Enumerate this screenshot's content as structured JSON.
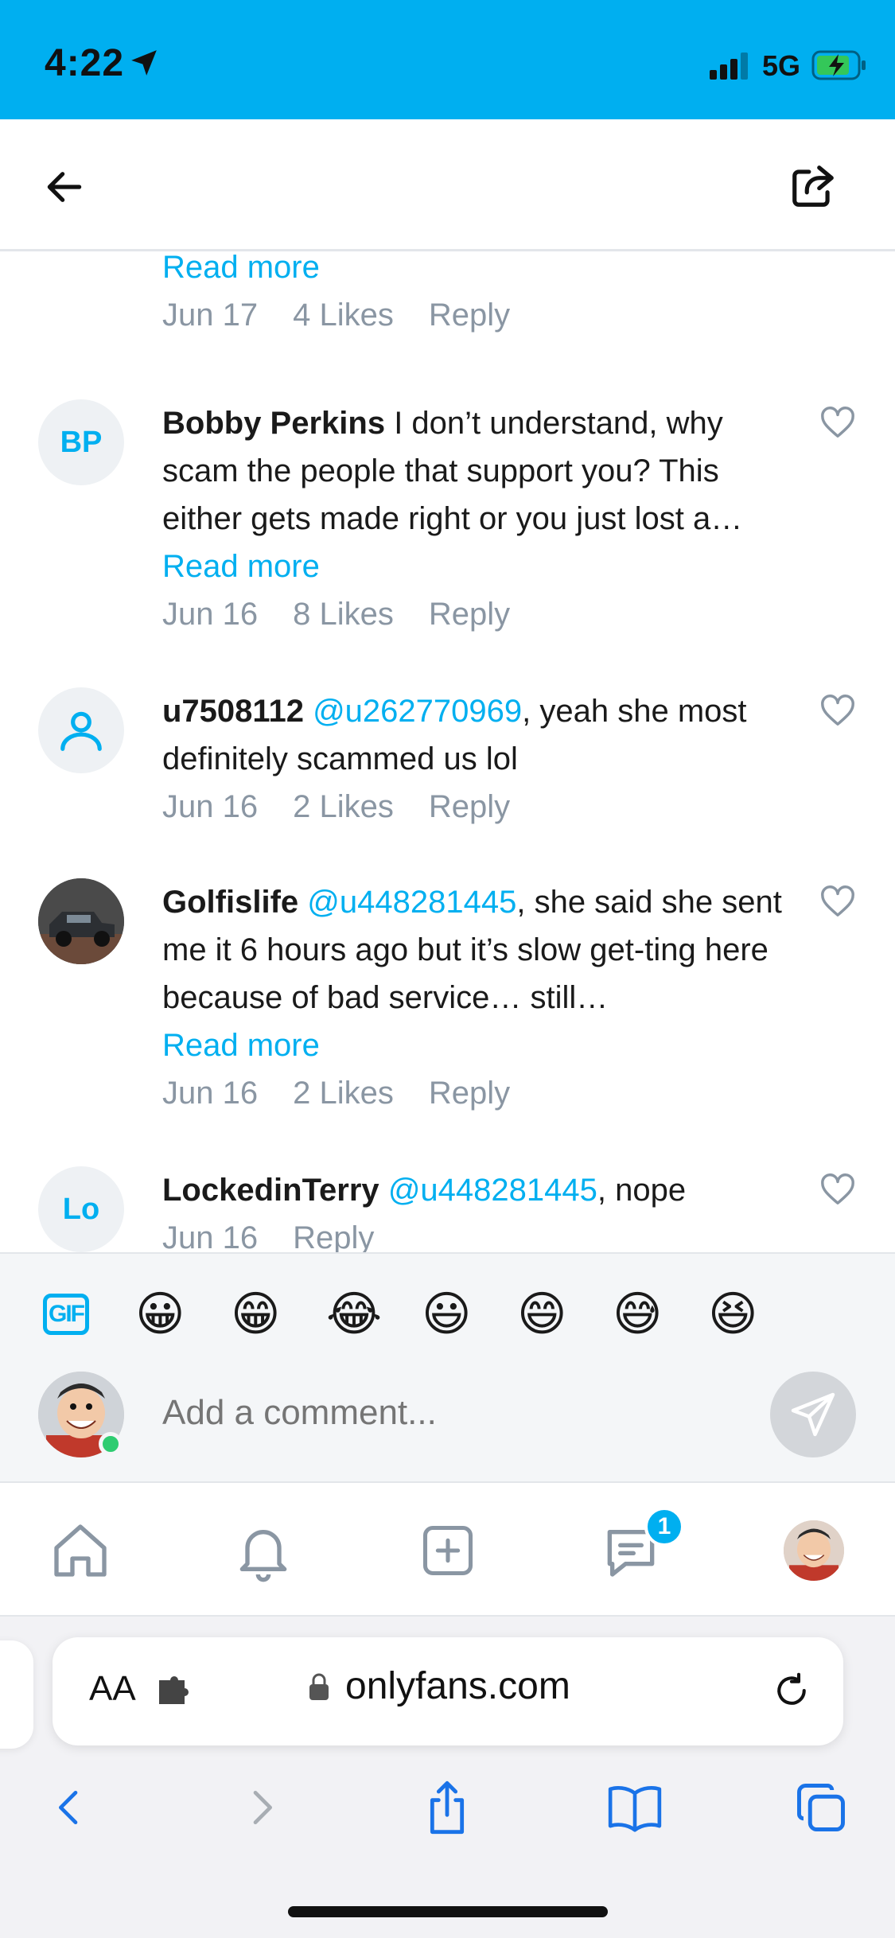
{
  "status_bar": {
    "time": "4:22",
    "network": "5G"
  },
  "header": {
    "back_icon": "arrow-left-icon",
    "share_icon": "share-icon"
  },
  "comments": [
    {
      "read_more": "Read more",
      "date": "Jun 17",
      "likes": "4 Likes",
      "reply": "Reply"
    },
    {
      "initials": "BP",
      "username": "Bobby Perkins",
      "text": " I don’t understand, why scam the people that support you? This either gets made right or you just lost a…",
      "read_more": "Read more",
      "date": "Jun 16",
      "likes": "8 Likes",
      "reply": "Reply"
    },
    {
      "username": "u7508112",
      "mention": "@u262770969",
      "text": ", yeah she most definitely scammed us lol",
      "date": "Jun 16",
      "likes": "2 Likes",
      "reply": "Reply"
    },
    {
      "username": "Golfislife",
      "mention": "@u448281445",
      "text": ", she said she sent me it 6 hours ago but it’s slow get-ting here because of bad service… still…",
      "read_more": "Read more",
      "date": "Jun 16",
      "likes": "2 Likes",
      "reply": "Reply"
    },
    {
      "initials": "Lo",
      "username": "LockedinTerry",
      "mention": "@u448281445",
      "text": ", nope",
      "date": "Jun 16",
      "reply": "Reply"
    }
  ],
  "composer": {
    "gif_label": "GIF",
    "emojis": [
      "😀",
      "😁",
      "😂",
      "😃",
      "😄",
      "😅",
      "😆"
    ],
    "placeholder": "Add a comment..."
  },
  "nav": {
    "messages_badge": "1"
  },
  "safari": {
    "aa_label": "AA",
    "url": "onlyfans.com"
  },
  "colors": {
    "accent": "#00AFF0",
    "muted": "#8a96a3"
  }
}
